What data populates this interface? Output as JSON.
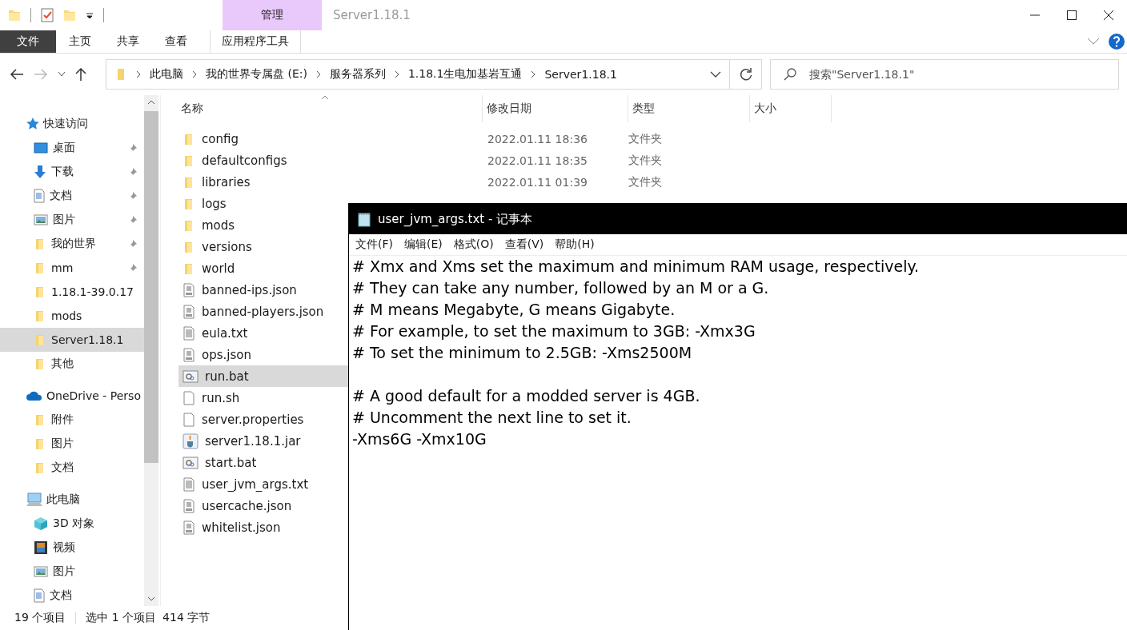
{
  "window": {
    "title": "Server1.18.1",
    "context_tab": "管理"
  },
  "ribbon_tabs": [
    {
      "label": "文件",
      "kind": "file"
    },
    {
      "label": "主页",
      "kind": "normal"
    },
    {
      "label": "共享",
      "kind": "normal"
    },
    {
      "label": "查看",
      "kind": "normal"
    },
    {
      "label": "应用程序工具",
      "kind": "context"
    }
  ],
  "address": {
    "breadcrumbs": [
      "此电脑",
      "我的世界专属盘 (E:)",
      "服务器系列",
      "1.18.1生电加基岩互通",
      "Server1.18.1"
    ],
    "search": {
      "placeholder": "搜索\"Server1.18.1\""
    }
  },
  "sidebar": {
    "groups": [
      {
        "label": "快速访问",
        "kind": "star",
        "children": [
          {
            "label": "桌面",
            "kind": "desktop",
            "pinned": true,
            "selected": false
          },
          {
            "label": "下载",
            "kind": "download",
            "pinned": true,
            "selected": false
          },
          {
            "label": "文档",
            "kind": "document",
            "pinned": true,
            "selected": false
          },
          {
            "label": "图片",
            "kind": "picture",
            "pinned": true,
            "selected": false
          },
          {
            "label": "我的世界",
            "kind": "folder",
            "pinned": true,
            "selected": false
          },
          {
            "label": "mm",
            "kind": "folder",
            "pinned": true,
            "selected": false
          },
          {
            "label": "1.18.1-39.0.17",
            "kind": "folder",
            "pinned": false,
            "selected": false
          },
          {
            "label": "mods",
            "kind": "folder",
            "pinned": false,
            "selected": false
          },
          {
            "label": "Server1.18.1",
            "kind": "folder",
            "pinned": false,
            "selected": true
          },
          {
            "label": "其他",
            "kind": "folder",
            "pinned": false,
            "selected": false
          }
        ]
      },
      {
        "label": "OneDrive - Perso",
        "kind": "cloud",
        "children": [
          {
            "label": "附件",
            "kind": "folder",
            "pinned": false,
            "selected": false
          },
          {
            "label": "图片",
            "kind": "folder",
            "pinned": false,
            "selected": false
          },
          {
            "label": "文档",
            "kind": "folder",
            "pinned": false,
            "selected": false
          }
        ]
      },
      {
        "label": "此电脑",
        "kind": "pc",
        "children": [
          {
            "label": "3D 对象",
            "kind": "cube",
            "pinned": false,
            "selected": false
          },
          {
            "label": "视频",
            "kind": "video",
            "pinned": false,
            "selected": false
          },
          {
            "label": "图片",
            "kind": "picture",
            "pinned": false,
            "selected": false
          },
          {
            "label": "文档",
            "kind": "document",
            "pinned": false,
            "selected": false
          }
        ]
      }
    ]
  },
  "file_list": {
    "columns": [
      "名称",
      "修改日期",
      "类型",
      "大小"
    ],
    "rows": [
      {
        "name": "config",
        "date": "2022.01.11 18:36",
        "type": "文件夹",
        "kind": "folder",
        "selected": false
      },
      {
        "name": "defaultconfigs",
        "date": "2022.01.11 18:35",
        "type": "文件夹",
        "kind": "folder",
        "selected": false
      },
      {
        "name": "libraries",
        "date": "2022.01.11 01:39",
        "type": "文件夹",
        "kind": "folder",
        "selected": false
      },
      {
        "name": "logs",
        "kind": "folder",
        "selected": false
      },
      {
        "name": "mods",
        "kind": "folder",
        "selected": false
      },
      {
        "name": "versions",
        "kind": "folder",
        "selected": false
      },
      {
        "name": "world",
        "kind": "folder",
        "selected": false
      },
      {
        "name": "banned-ips.json",
        "kind": "json",
        "selected": false
      },
      {
        "name": "banned-players.json",
        "kind": "json",
        "selected": false
      },
      {
        "name": "eula.txt",
        "kind": "txt",
        "selected": false
      },
      {
        "name": "ops.json",
        "kind": "json",
        "selected": false
      },
      {
        "name": "run.bat",
        "kind": "bat",
        "selected": true
      },
      {
        "name": "run.sh",
        "kind": "blank",
        "selected": false
      },
      {
        "name": "server.properties",
        "kind": "blank",
        "selected": false
      },
      {
        "name": "server1.18.1.jar",
        "kind": "jar",
        "selected": false
      },
      {
        "name": "start.bat",
        "kind": "bat",
        "selected": false
      },
      {
        "name": "user_jvm_args.txt",
        "kind": "txt",
        "selected": false
      },
      {
        "name": "usercache.json",
        "kind": "json",
        "selected": false
      },
      {
        "name": "whitelist.json",
        "kind": "json",
        "selected": false
      }
    ]
  },
  "status_bar": [
    "19 个项目",
    "选中 1 个项目",
    "414 字节"
  ],
  "notepad": {
    "title": "user_jvm_args.txt - 记事本",
    "menu": [
      "文件(F)",
      "编辑(E)",
      "格式(O)",
      "查看(V)",
      "帮助(H)"
    ],
    "text": "# Xmx and Xms set the maximum and minimum RAM usage, respectively.\n# They can take any number, followed by an M or a G.\n# M means Megabyte, G means Gigabyte.\n# For example, to set the maximum to 3GB: -Xmx3G\n# To set the minimum to 2.5GB: -Xms2500M\n\n# A good default for a modded server is 4GB.\n# Uncomment the next line to set it.\n-Xms6G -Xmx10G"
  }
}
